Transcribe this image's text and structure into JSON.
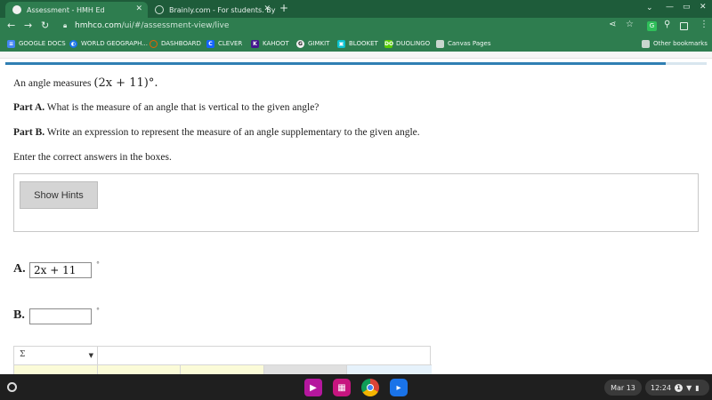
{
  "tabs": [
    {
      "title": "Assessment - HMH Ed",
      "active": true
    },
    {
      "title": "Brainly.com - For students. By st",
      "active": false
    }
  ],
  "new_tab_label": "+",
  "address_bar": {
    "host": "hmhco.com",
    "path": "/ui/#/assessment-view/live"
  },
  "bookmarks": [
    {
      "label": "GOOGLE DOCS",
      "icon": "docs-icon",
      "color": "#4285f4"
    },
    {
      "label": "WORLD GEOGRAPH...",
      "icon": "globe-icon",
      "color": "#1a73e8"
    },
    {
      "label": "DASHBOARD",
      "icon": "dashboard-icon",
      "color": "#e66000"
    },
    {
      "label": "CLEVER",
      "icon": "clever-icon",
      "color": "#1464ff"
    },
    {
      "label": "KAHOOT",
      "icon": "kahoot-icon",
      "color": "#46178f"
    },
    {
      "label": "GIMKIT",
      "icon": "gimkit-icon",
      "color": "#3b3b3b"
    },
    {
      "label": "BLOOKET",
      "icon": "blooket-icon",
      "color": "#0bc2cf"
    },
    {
      "label": "DUOLINGO",
      "icon": "duolingo-icon",
      "color": "#58cc02"
    },
    {
      "label": "Canvas Pages",
      "icon": "folder-icon",
      "color": "#c9d6cf"
    }
  ],
  "other_bookmarks": "Other bookmarks",
  "question": {
    "intro_prefix": "An angle measures ",
    "intro_math": "(2x + 11)°.",
    "part_a_label": "Part A.",
    "part_a_text": " What is the measure of an angle that is vertical to the given angle?",
    "part_b_label": "Part B.",
    "part_b_text": " Write an expression to represent the measure of an angle supplementary to the given angle.",
    "instruction": "Enter the correct answers in the boxes."
  },
  "hints_button": "Show Hints",
  "answers": [
    {
      "label": "A.",
      "value": "2x + 11",
      "unit": "°"
    },
    {
      "label": "B.",
      "value": "",
      "unit": "°"
    }
  ],
  "editor": {
    "symbol_select": "Σ"
  },
  "shelf": {
    "date": "Mar 13",
    "time": "12:24",
    "notifications": "1",
    "apps": [
      {
        "name": "screencast-app-icon",
        "color": "#b5179e"
      },
      {
        "name": "gallery-app-icon",
        "color": "#c7157f"
      },
      {
        "name": "chrome-icon",
        "color": "#db4437"
      },
      {
        "name": "meet-icon",
        "color": "#1a73e8"
      }
    ]
  }
}
